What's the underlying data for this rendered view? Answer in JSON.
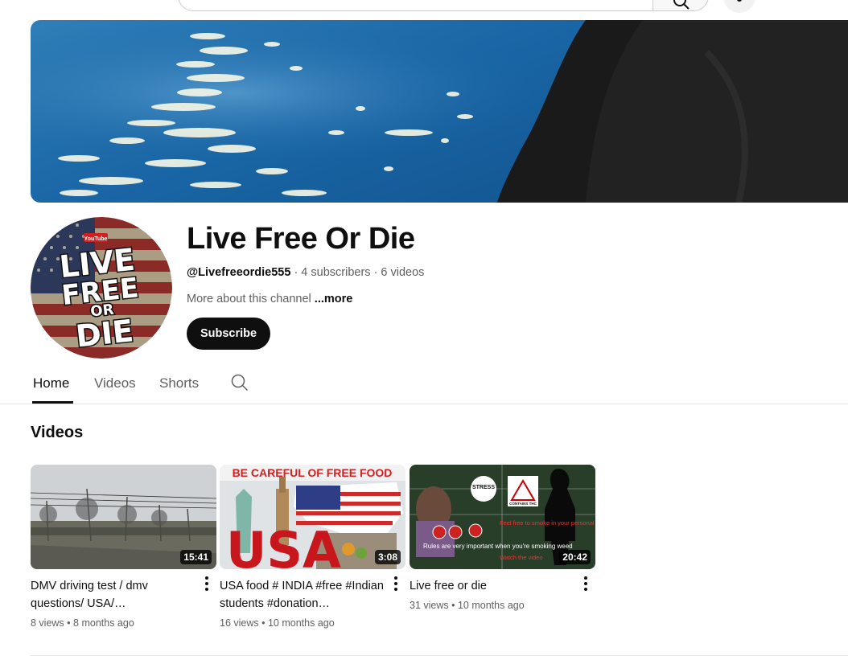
{
  "channel": {
    "name": "Live Free Or Die",
    "handle": "@Livefreeordie555",
    "subscribers": "4 subscribers",
    "videos_count": "6 videos",
    "about": "More about this channel",
    "more": "...more",
    "subscribe_label": "Subscribe",
    "avatar_text": {
      "youtube": "YouTube",
      "line1": "LIVE",
      "line2": "FREE",
      "line3": "OR",
      "line4": "DIE"
    }
  },
  "tabs": [
    {
      "label": "Home",
      "active": true
    },
    {
      "label": "Videos",
      "active": false
    },
    {
      "label": "Shorts",
      "active": false
    }
  ],
  "section_title": "Videos",
  "videos": [
    {
      "title": "DMV driving test / dmv questions/ USA/…",
      "duration": "15:41",
      "views": "8 views",
      "age": "8 months ago"
    },
    {
      "title": "USA food # INDIA #free #Indian students #donation…",
      "duration": "3:08",
      "views": "16 views",
      "age": "10 months ago",
      "thumb_text": {
        "headline": "BE CAREFUL OF FREE FOOD",
        "big": "USA"
      }
    },
    {
      "title": "Live free or die",
      "duration": "20:42",
      "views": "31 views",
      "age": "10 months ago",
      "thumb_text": {
        "stress": "STRESS",
        "thc": "CONTAINS THC",
        "red": "Feel free to smoke in your personal life",
        "white": "Rules are very important when you're smoking weed",
        "watch": "Watch the video"
      }
    }
  ],
  "icons": [
    "search-icon",
    "mic-icon",
    "tab-search-icon",
    "more-vert-icon"
  ],
  "colors": {
    "text": "#0f0f0f",
    "secondary": "#606060",
    "subscribe_bg": "#0f0f0f"
  }
}
